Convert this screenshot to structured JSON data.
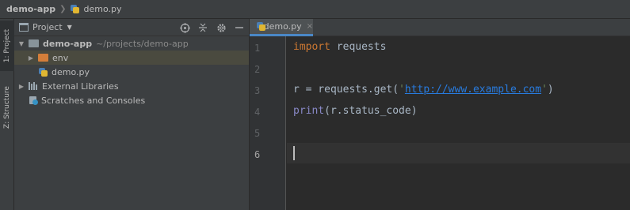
{
  "breadcrumb": {
    "project": "demo-app",
    "file": "demo.py"
  },
  "toolstrip": {
    "project_tab": "1: Project",
    "structure_tab": "Z: Structure"
  },
  "project_panel": {
    "title": "Project",
    "icons": [
      "locate-icon",
      "collapse-icon",
      "gear-icon",
      "hide-icon"
    ],
    "tree": {
      "root_name": "demo-app",
      "root_path": "~/projects/demo-app",
      "env": "env",
      "demo_file": "demo.py",
      "external_libraries": "External Libraries",
      "scratches": "Scratches and Consoles"
    }
  },
  "editor": {
    "tab_label": "demo.py",
    "tab_close": "×",
    "line_numbers": [
      "1",
      "2",
      "3",
      "4",
      "5",
      "6"
    ],
    "current_line": "6",
    "code": {
      "l1_kw": "import",
      "l1_rest": " requests",
      "l3_pre": "r = requests.get(",
      "l3_q1": "'",
      "l3_url": "http://www.example.com",
      "l3_q2": "'",
      "l3_post": ")",
      "l4_fn": "print",
      "l4_rest": "(r.status_code)"
    }
  },
  "colors": {
    "keyword": "#cc7832",
    "builtin": "#8888c6",
    "string": "#6a8759",
    "url": "#287bde",
    "tab_underline": "#4a88c7"
  }
}
